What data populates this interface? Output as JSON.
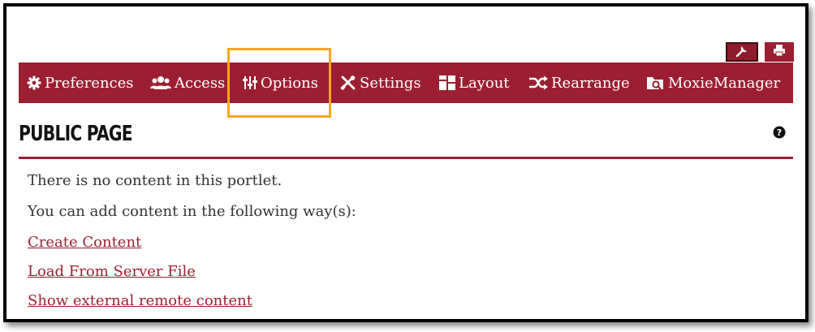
{
  "top_buttons": {
    "wrench_icon": "wrench-icon",
    "print_icon": "print-icon"
  },
  "toolbar": {
    "items": [
      {
        "label": "Preferences",
        "icon": "gear-icon"
      },
      {
        "label": "Access",
        "icon": "users-icon"
      },
      {
        "label": "Options",
        "icon": "sliders-icon"
      },
      {
        "label": "Settings",
        "icon": "tools-icon"
      },
      {
        "label": "Layout",
        "icon": "layout-icon"
      },
      {
        "label": "Rearrange",
        "icon": "shuffle-icon"
      },
      {
        "label": "MoxieManager",
        "icon": "folder-search-icon"
      }
    ],
    "highlighted_item": "Options"
  },
  "portlet": {
    "title": "PUBLIC PAGE",
    "help_icon": "question-circle-icon",
    "empty_message": "There is no content in this portlet.",
    "add_prompt": "You can add content in the following way(s):",
    "links": [
      "Create Content",
      "Load From Server File",
      "Show external remote content"
    ]
  },
  "colors": {
    "brand": "#9b1f31",
    "highlight": "#f5a81c",
    "text": "#333333"
  }
}
